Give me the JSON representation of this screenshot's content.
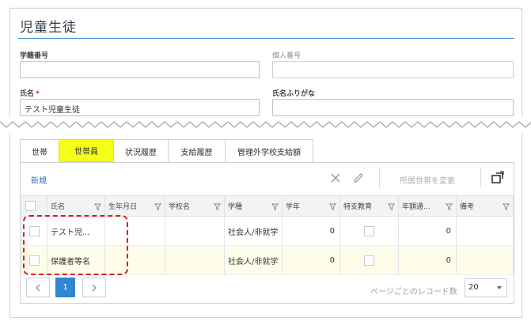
{
  "page": {
    "title": "児童生徒"
  },
  "form": {
    "student_no_label": "学籍番号",
    "student_no_value": "",
    "personal_no_label": "個人番号",
    "personal_no_value": "",
    "name_label": "氏名",
    "name_required": "*",
    "name_value": "テスト児童生徒",
    "kana_label": "氏名ふりがな",
    "kana_value": ""
  },
  "tabs": [
    {
      "label": "世帯",
      "active": false
    },
    {
      "label": "世帯員",
      "active": true
    },
    {
      "label": "状況履歴",
      "active": false
    },
    {
      "label": "支給履歴",
      "active": false
    },
    {
      "label": "管理外学校支給額",
      "active": false
    }
  ],
  "toolbar": {
    "new_label": "新規",
    "delete_icon": "close-icon",
    "edit_icon": "pencil-icon",
    "move_label": "所属世帯を変更",
    "export_icon": "export-icon"
  },
  "table": {
    "columns": [
      "氏名",
      "生年月日",
      "学校名",
      "学種",
      "学年",
      "特支教育",
      "年額通...",
      "備考"
    ],
    "rows": [
      {
        "name": "テスト児...",
        "birth": "",
        "school": "",
        "type": "社会人/非就学",
        "grade": "0",
        "special": false,
        "annual": "0",
        "note": ""
      },
      {
        "name": "保護者等名",
        "birth": "",
        "school": "",
        "type": "社会人/非就学",
        "grade": "0",
        "special": false,
        "annual": "0",
        "note": ""
      }
    ]
  },
  "pager": {
    "prev": "‹",
    "current": "1",
    "next": "›",
    "rpp_label": "ページごとのレコード数",
    "rpp_value": "20"
  },
  "colors": {
    "accent": "#2f86d1",
    "highlight": "#f5ff1a",
    "annotation": "#e0161a",
    "row_alt": "#fdfde9"
  }
}
